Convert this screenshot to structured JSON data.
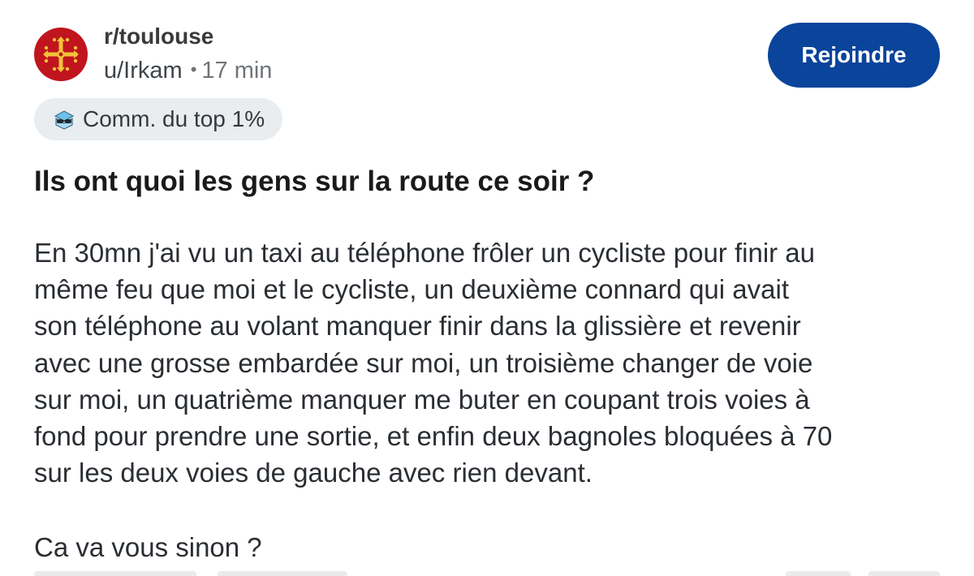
{
  "header": {
    "subreddit": "r/toulouse",
    "author": "u/Irkam",
    "separator": "•",
    "time": "17 min",
    "join_label": "Rejoindre",
    "avatar_icon": "occitan-cross-icon",
    "avatar_color": "#c0141e",
    "join_color": "#0a449b"
  },
  "flair": {
    "icon": "sunglasses-icon",
    "label": "Comm. du top 1%"
  },
  "post": {
    "title": "Ils ont quoi les gens sur la route ce soir ?",
    "body_paragraph_1": "En 30mn j'ai vu un taxi au téléphone frôler un cycliste pour finir au\nmême feu que moi et le cycliste, un deuxième connard qui avait\nson téléphone au volant manquer finir dans la glissière et revenir\navec une grosse embardée sur moi, un troisième changer de voie\nsur moi, un quatrième manquer me buter en coupant trois voies à\nfond pour prendre une sortie, et enfin deux bagnoles bloquées à 70\nsur les deux voies de gauche avec rien devant.",
    "body_paragraph_2": "Ca va vous sinon ?"
  }
}
